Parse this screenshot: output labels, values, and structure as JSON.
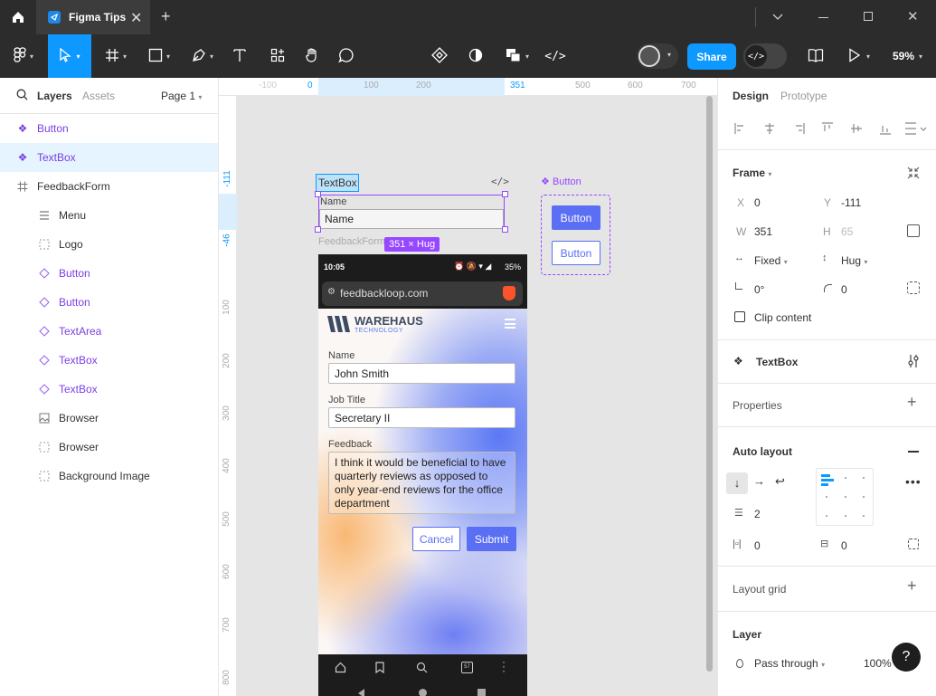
{
  "tabs": {
    "active_title": "Figma Tips"
  },
  "toolbar": {
    "share": "Share",
    "zoom": "59%"
  },
  "left": {
    "tab_layers": "Layers",
    "tab_assets": "Assets",
    "page": "Page 1",
    "layers": [
      {
        "label": "Button",
        "icon": "component-icon",
        "level": 0,
        "purple": true
      },
      {
        "label": "TextBox",
        "icon": "component-icon",
        "level": 0,
        "purple": true,
        "selected": true
      },
      {
        "label": "FeedbackForm",
        "icon": "frame-icon",
        "level": 0,
        "purple": false
      },
      {
        "label": "Menu",
        "icon": "menu-icon",
        "level": 1,
        "purple": false
      },
      {
        "label": "Logo",
        "icon": "dashed-box-icon",
        "level": 1,
        "purple": false
      },
      {
        "label": "Button",
        "icon": "instance-icon",
        "level": 1,
        "purple": true
      },
      {
        "label": "Button",
        "icon": "instance-icon",
        "level": 1,
        "purple": true
      },
      {
        "label": "TextArea",
        "icon": "instance-icon",
        "level": 1,
        "purple": true
      },
      {
        "label": "TextBox",
        "icon": "instance-icon",
        "level": 1,
        "purple": true
      },
      {
        "label": "TextBox",
        "icon": "instance-icon",
        "level": 1,
        "purple": true
      },
      {
        "label": "Browser",
        "icon": "image-icon",
        "level": 1,
        "purple": false
      },
      {
        "label": "Browser",
        "icon": "dashed-box-icon",
        "level": 1,
        "purple": false
      },
      {
        "label": "Background Image",
        "icon": "dashed-box-icon",
        "level": 1,
        "purple": false
      }
    ]
  },
  "canvas": {
    "ruler_top": [
      "-100",
      "0",
      "100",
      "200",
      "300",
      "351",
      "500",
      "600",
      "700"
    ],
    "ruler_left": [
      "-111",
      "-46",
      "100",
      "200",
      "300",
      "400",
      "500",
      "600",
      "700",
      "800"
    ],
    "textbox_tag": "TextBox",
    "textbox_label": "Name",
    "textbox_value": "Name",
    "size_badge": "351 × Hug",
    "feedback_label": "FeedbackForm",
    "button_component": "Button",
    "button_primary": "Button",
    "button_secondary": "Button",
    "code_glyph": "</>"
  },
  "phone": {
    "time": "10:05",
    "battery": "35%",
    "url": "feedbackloop.com",
    "brand": "WAREHAUS",
    "brand_sub": "TECHNOLOGY",
    "name_label": "Name",
    "name_value": "John Smith",
    "job_label": "Job Title",
    "job_value": "Secretary II",
    "feedback_label": "Feedback",
    "feedback_value": "I think it would be beneficial to have quarterly reviews as opposed to only year-end reviews for the office department",
    "cancel": "Cancel",
    "submit": "Submit",
    "tab_count": "57"
  },
  "right": {
    "tab_design": "Design",
    "tab_prototype": "Prototype",
    "frame_title": "Frame",
    "x_lbl": "X",
    "x_val": "0",
    "y_lbl": "Y",
    "y_val": "-111",
    "w_lbl": "W",
    "w_val": "351",
    "h_lbl": "H",
    "h_val": "65",
    "w_mode": "Fixed",
    "h_mode": "Hug",
    "rotation": "0°",
    "radius": "0",
    "clip": "Clip content",
    "component_name": "TextBox",
    "properties": "Properties",
    "auto_layout": "Auto layout",
    "gap": "2",
    "pad_h": "0",
    "pad_v": "0",
    "layout_grid": "Layout grid",
    "layer": "Layer",
    "blend": "Pass through",
    "opacity": "100%",
    "help": "?"
  }
}
